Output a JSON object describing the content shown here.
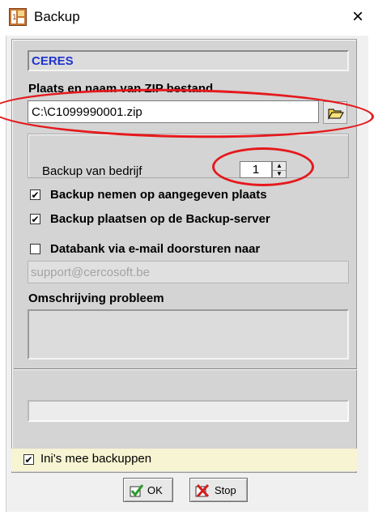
{
  "window": {
    "title": "Backup",
    "close_glyph": "×",
    "icon": "app-icon"
  },
  "company_field": {
    "value": "CERES",
    "color": "#1f33ce"
  },
  "zip": {
    "label": "Plaats en naam van ZIP bestand",
    "value": "C:\\C1099990001.zip",
    "browse_icon": "folder-open-icon"
  },
  "backup_company": {
    "label": "Backup van bedrijf",
    "value": "1"
  },
  "options": [
    {
      "label": "Backup nemen op aangegeven plaats",
      "checked": true
    },
    {
      "label": "Backup plaatsen op de Backup-server",
      "checked": true
    },
    {
      "label": "Databank via e-mail doorsturen naar",
      "checked": false
    }
  ],
  "email": {
    "value": "support@cercosoft.be"
  },
  "problem": {
    "label": "Omschrijving probleem",
    "value": ""
  },
  "status": {
    "value": ""
  },
  "ini": {
    "label": "Ini's mee backuppen",
    "checked": true
  },
  "buttons": {
    "ok": "OK",
    "stop": "Stop"
  },
  "check_glyph": "✔",
  "colors": {
    "annotation": "#e5191c",
    "ini_background": "#f6f4d2"
  }
}
